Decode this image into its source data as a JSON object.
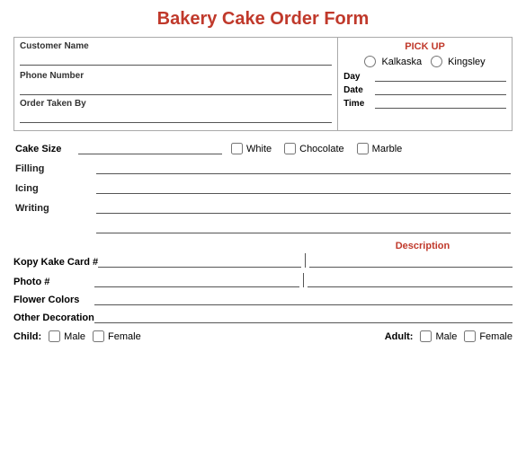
{
  "title": "Bakery Cake Order Form",
  "topSection": {
    "customerNameLabel": "Customer Name",
    "phoneNumberLabel": "Phone Number",
    "orderTakenByLabel": "Order Taken By",
    "pickupHeader": "PICK UP",
    "kalkaskaLabel": "Kalkaska",
    "kingsleyLabel": "Kingsley",
    "dayLabel": "Day",
    "dateLabel": "Date",
    "timeLabel": "Time"
  },
  "formSection": {
    "cakeSizeLabel": "Cake Size",
    "whiteLabel": "White",
    "chocolateLabel": "Chocolate",
    "marbleLabel": "Marble",
    "fillingLabel": "Filling",
    "icingLabel": "Icing",
    "writingLabel": "Writing"
  },
  "descSection": {
    "descriptionHeader": "Description",
    "kopyKakeLabel": "Kopy Kake Card #",
    "photoLabel": "Photo #",
    "flowerColorsLabel": "Flower Colors",
    "otherDecorationLabel": "Other Decoration"
  },
  "bottomSection": {
    "childLabel": "Child:",
    "maleLabel": "Male",
    "femaleLabel": "Female",
    "adultLabel": "Adult:",
    "adultMaleLabel": "Male",
    "adultFemaleLabel": "Female"
  }
}
